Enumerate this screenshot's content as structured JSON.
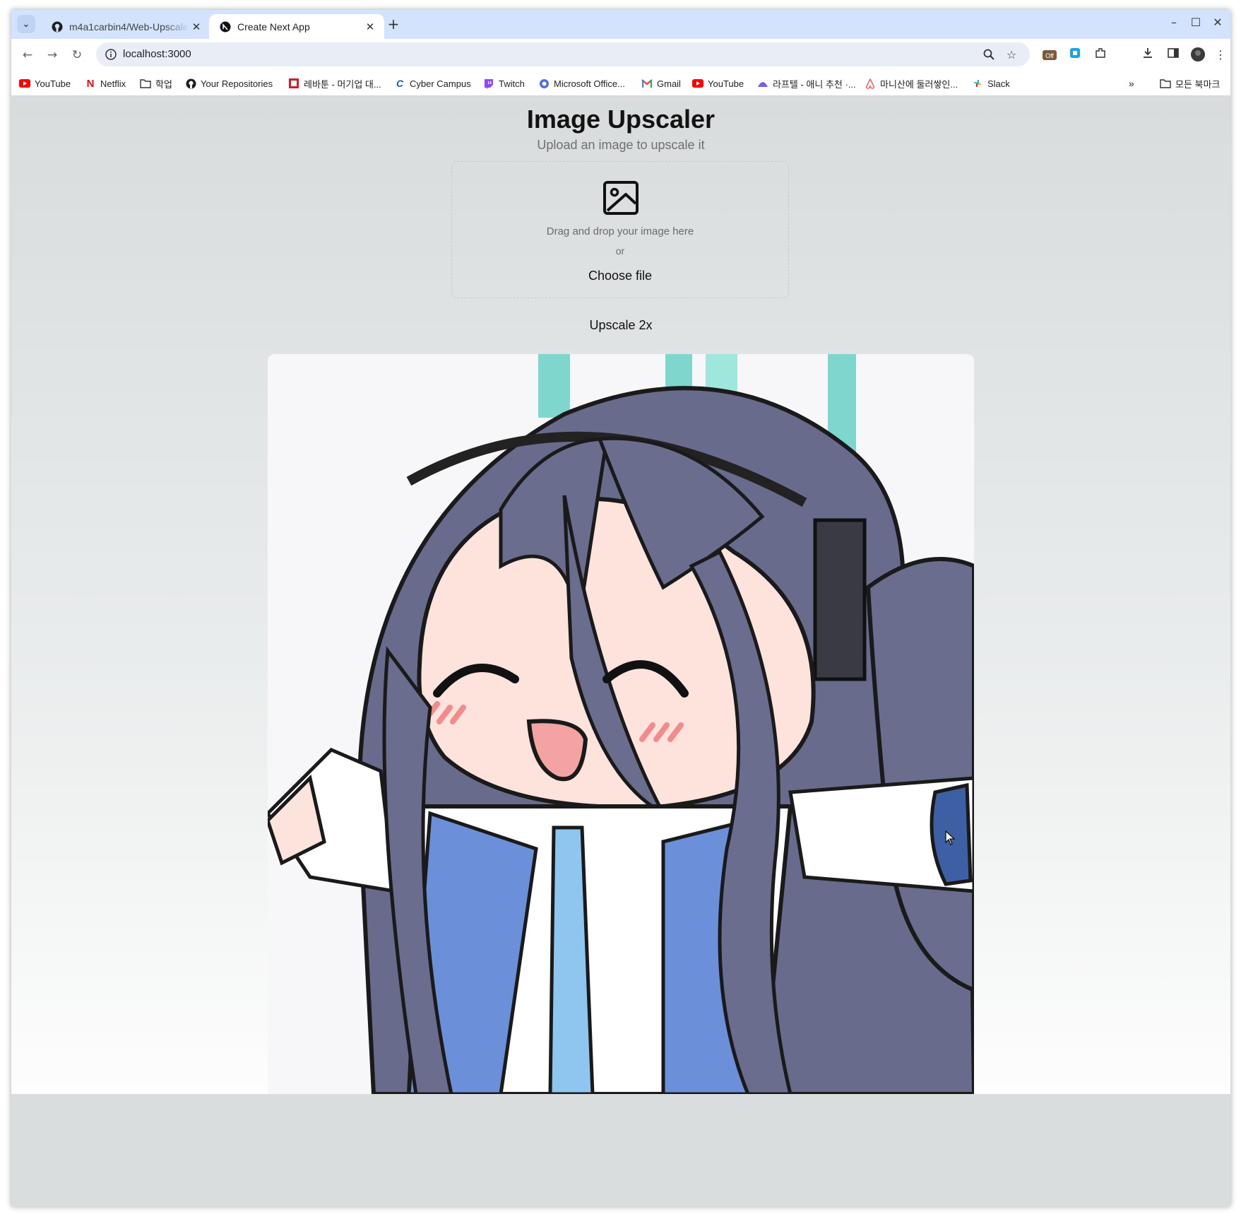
{
  "browser": {
    "tabs": [
      {
        "title": "m4a1carbin4/Web-Upscaler",
        "active": false,
        "icon": "github-icon"
      },
      {
        "title": "Create Next App",
        "active": true,
        "icon": "nextjs-icon"
      }
    ],
    "url": "localhost:3000",
    "bookmarks": [
      {
        "label": "YouTube",
        "icon": "youtube-icon"
      },
      {
        "label": "Netflix",
        "icon": "netflix-icon"
      },
      {
        "label": "학업",
        "icon": "folder-icon"
      },
      {
        "label": "Your Repositories",
        "icon": "github-icon"
      },
      {
        "label": "레바툰 - 머기업 대...",
        "icon": "rebatoon-icon"
      },
      {
        "label": "Cyber Campus",
        "icon": "cybercampus-icon"
      },
      {
        "label": "Twitch",
        "icon": "twitch-icon"
      },
      {
        "label": "Microsoft Office...",
        "icon": "office-icon"
      },
      {
        "label": "Gmail",
        "icon": "gmail-icon"
      },
      {
        "label": "YouTube",
        "icon": "youtube-icon"
      },
      {
        "label": "라프텔 - 애니 추천 ·...",
        "icon": "laftel-icon"
      },
      {
        "label": "마니산에 둘러쌓인...",
        "icon": "airbnb-icon"
      },
      {
        "label": "Slack",
        "icon": "slack-icon"
      }
    ],
    "all_bookmarks_label": "모든 북마크",
    "extension_badge": "Off"
  },
  "page": {
    "title": "Image Upscaler",
    "subtitle": "Upload an image to upscale it",
    "dropzone": {
      "drag_text": "Drag and drop your image here",
      "or_text": "or",
      "choose_label": "Choose file"
    },
    "upscale_button": "Upscale 2x"
  },
  "colors": {
    "tabstrip": "#d3e3fd",
    "omnibox": "#e9eef6",
    "page_bg_top": "#d8dcdc",
    "hair": "#6a6a8a",
    "tie": "#8ec6f0",
    "jacket": "#6b8fd8",
    "blush": "#f28b8b"
  }
}
